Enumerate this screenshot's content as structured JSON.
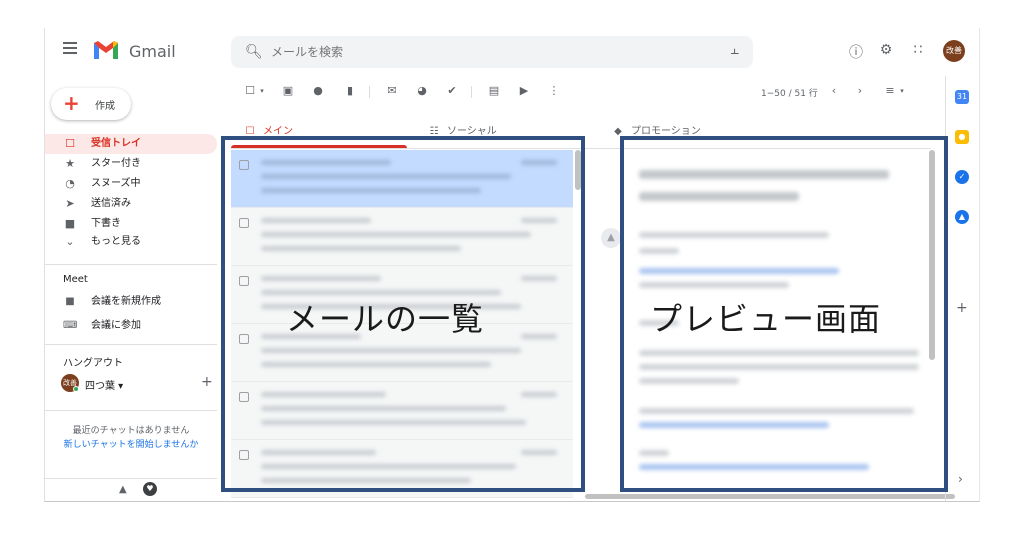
{
  "header": {
    "brand": "Gmail",
    "search_placeholder": "メールを検索",
    "avatar_text": "改善"
  },
  "sidebar": {
    "compose_label": "作成",
    "items": [
      {
        "label": "受信トレイ",
        "icon": "inbox-icon",
        "active": true
      },
      {
        "label": "スター付き",
        "icon": "star-icon"
      },
      {
        "label": "スヌーズ中",
        "icon": "clock-icon"
      },
      {
        "label": "送信済み",
        "icon": "send-icon"
      },
      {
        "label": "下書き",
        "icon": "draft-icon"
      },
      {
        "label": "もっと見る",
        "icon": "chevron-down-icon"
      }
    ],
    "meet_title": "Meet",
    "meet_items": [
      {
        "label": "会議を新規作成",
        "icon": "video-icon"
      },
      {
        "label": "会議に参加",
        "icon": "keyboard-icon"
      }
    ],
    "hangouts_title": "ハングアウト",
    "hangouts_user_avatar": "改善",
    "hangouts_user": "四つ葉 ▾",
    "no_chat_text": "最近のチャットはありません",
    "start_chat_link": "新しいチャットを開始しませんか"
  },
  "toolbar": {
    "pager": "1−50 / 51 行"
  },
  "tabs": [
    {
      "label": "メイン",
      "icon": "inbox-icon",
      "active": true
    },
    {
      "label": "ソーシャル",
      "icon": "people-icon"
    },
    {
      "label": "プロモーション",
      "icon": "tag-icon"
    }
  ],
  "annotations": {
    "list_label": "メールの一覧",
    "preview_label": "プレビュー画面",
    "box_color": "#2f4f80"
  },
  "colors": {
    "accent_red": "#d93025",
    "selected_row": "#c2dbff"
  }
}
